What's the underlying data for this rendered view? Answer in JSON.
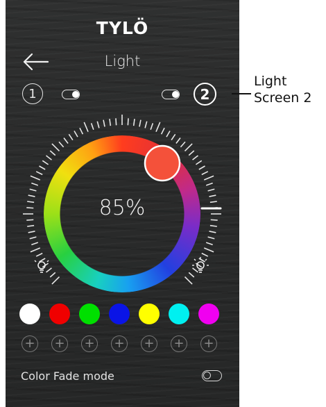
{
  "header": {
    "brand": "TYLÖ",
    "title": "Light",
    "back_icon": "arrow-left-icon"
  },
  "screens": {
    "left_number": "1",
    "right_number": "2"
  },
  "toggles": {
    "left_on": true,
    "right_on": true
  },
  "dial": {
    "percent_label": "85%",
    "brightness_fraction": 0.85,
    "selected_color": "#f4513a",
    "dim_icon": "bulb-dim-icon",
    "bright_icon": "bulb-bright-icon"
  },
  "swatches": [
    {
      "name": "white",
      "color": "#ffffff"
    },
    {
      "name": "red",
      "color": "#f00000"
    },
    {
      "name": "green",
      "color": "#00e000"
    },
    {
      "name": "blue",
      "color": "#0a14e6"
    },
    {
      "name": "yellow",
      "color": "#ffff00"
    },
    {
      "name": "cyan",
      "color": "#00f0f0"
    },
    {
      "name": "magenta",
      "color": "#f000f0"
    }
  ],
  "add_slots": [
    "+",
    "+",
    "+",
    "+",
    "+",
    "+",
    "+"
  ],
  "fade": {
    "label": "Color Fade mode",
    "enabled": false
  },
  "callout": {
    "line1": "Light",
    "line2": "Screen 2"
  }
}
